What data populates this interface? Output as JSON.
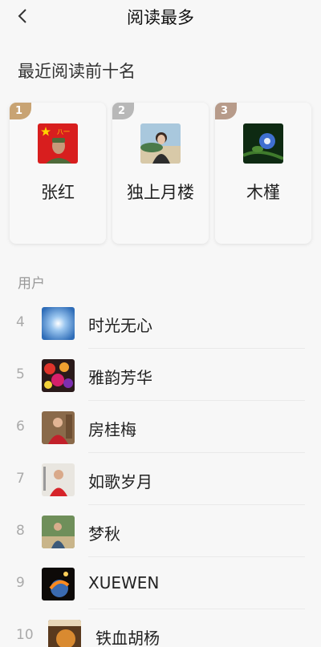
{
  "header": {
    "title": "阅读最多",
    "back_icon": "chevron-left-icon"
  },
  "section_title": "最近阅读前十名",
  "top3": [
    {
      "rank": "1",
      "name": "张红",
      "badge_color": "#c8a373"
    },
    {
      "rank": "2",
      "name": "独上月楼",
      "badge_color": "#b8b8b8"
    },
    {
      "rank": "3",
      "name": "木槿",
      "badge_color": "#b79b8a"
    }
  ],
  "users_label": "用户",
  "list": [
    {
      "rank": "4",
      "name": "时光无心"
    },
    {
      "rank": "5",
      "name": "雅韵芳华"
    },
    {
      "rank": "6",
      "name": "房桂梅"
    },
    {
      "rank": "7",
      "name": "如歌岁月"
    },
    {
      "rank": "8",
      "name": "梦秋"
    },
    {
      "rank": "9",
      "name": "XUEWEN"
    },
    {
      "rank": "10",
      "name": "铁血胡杨"
    }
  ]
}
